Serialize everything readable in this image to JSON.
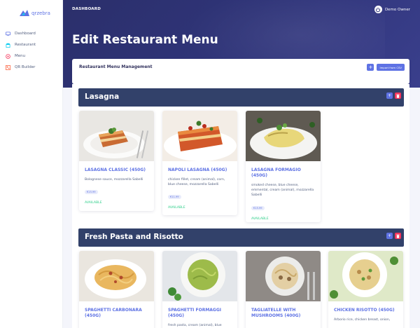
{
  "brand": {
    "logo_text": "qrzebra"
  },
  "sidebar": {
    "items": [
      {
        "label": "Dashboard",
        "icon": "monitor-icon",
        "color": "#5e72e4"
      },
      {
        "label": "Restaurant",
        "icon": "shop-icon",
        "color": "#11cdef"
      },
      {
        "label": "Menu",
        "icon": "menu-icon",
        "color": "#f5365c"
      },
      {
        "label": "QR Builder",
        "icon": "qr-icon",
        "color": "#fb6340"
      }
    ]
  },
  "header": {
    "breadcrumb": "DASHBOARD",
    "user_name": "Demo Owner",
    "page_title": "Edit Restaurant Menu"
  },
  "management": {
    "title": "Restaurant Menu Management",
    "add_label": "+",
    "import_label": "Import from CSV"
  },
  "categories": [
    {
      "title": "Lasagna",
      "items": [
        {
          "name": "LASAGNA CLASSIC (450G)",
          "desc": "Bolognese sauce, mozzarella Sabelli",
          "price": "€15.99",
          "status": "AVAILABLE"
        },
        {
          "name": "NAPOLI LASAGNA (450G)",
          "desc": "chicken fillet, cream (animal), corn, blue cheese, mozzarella Sabelli",
          "price": "€11.99",
          "status": "AVAILABLE"
        },
        {
          "name": "LASAGNA FORMAGIO (450G)",
          "desc": "smoked cheese, blue cheese, emmental, cream (animal), mozzarella Sabelli",
          "price": "€15.99",
          "status": "AVAILABLE"
        }
      ]
    },
    {
      "title": "Fresh Pasta and Risotto",
      "items": [
        {
          "name": "SPAGHETTI CARBONARA (450G)",
          "desc": ""
        },
        {
          "name": "SPAGHETTI FORMAGGI (450G)",
          "desc": "fresh pasta, cream (animal), blue"
        },
        {
          "name": "TAGLIATELLE WITH MUSHROOMS (400G)",
          "desc": ""
        },
        {
          "name": "CHICKEN RISOTTO (450G)",
          "desc": "Arborio rice, chicken breast, onion,"
        }
      ]
    }
  ],
  "colors": {
    "accent": "#5e72e4",
    "danger": "#f5365c",
    "success": "#2dce89",
    "category_bar": "#32416a",
    "header": "#2f3478"
  }
}
